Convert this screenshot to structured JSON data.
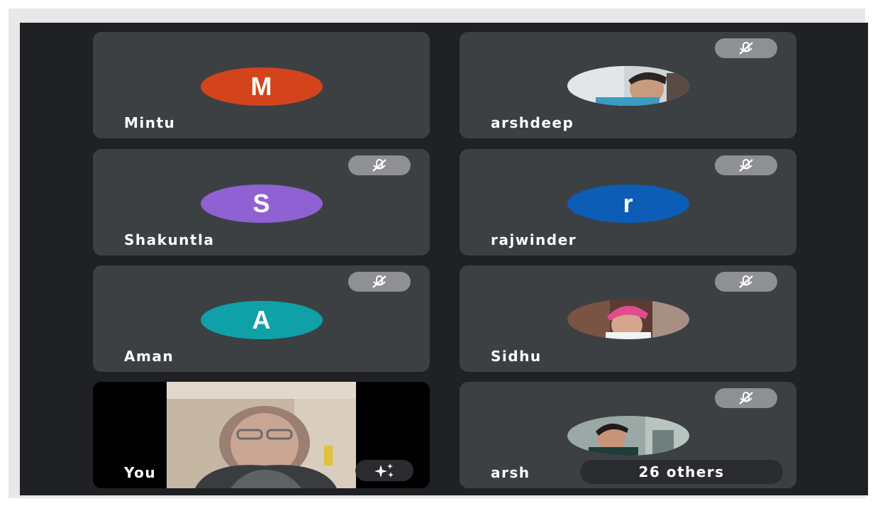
{
  "participants": [
    {
      "name": "Mintu",
      "initial": "M",
      "color": "#d3441c",
      "muted": false
    },
    {
      "name": "arshdeep",
      "photo": "avatar-photo",
      "muted": true
    },
    {
      "name": "Shakuntla",
      "initial": "S",
      "color": "#9061d2",
      "muted": true
    },
    {
      "name": "rajwinder",
      "initial": "r",
      "color": "#0b5db6",
      "muted": true
    },
    {
      "name": "Aman",
      "initial": "A",
      "color": "#0fa0a8",
      "muted": true
    },
    {
      "name": "Sidhu",
      "photo": "avatar-photo",
      "muted": true
    },
    {
      "name": "You",
      "self_view": true,
      "muted": false
    },
    {
      "name": "arsh",
      "photo": "avatar-photo",
      "muted": true
    }
  ],
  "overflow": {
    "label": "26 others"
  },
  "icons": {
    "mute": "mic-off-icon",
    "effects": "sparkle-effects-icon"
  },
  "colors": {
    "background": "#202124",
    "tile": "#3c4043",
    "mute_badge": "#8e9094"
  }
}
